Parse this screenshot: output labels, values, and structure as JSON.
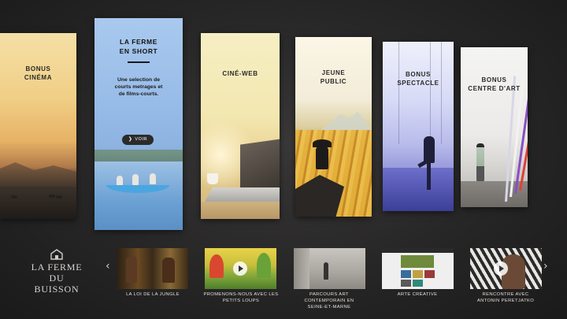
{
  "cards": [
    {
      "title": "BONUS\nCINÉMA"
    },
    {
      "title": "LA FERME\nEN SHORT",
      "description": "Une selection de\ncourts metrages et\nde films-courts.",
      "button_label": "VOIR"
    },
    {
      "title": "CINÉ-WEB"
    },
    {
      "title": "JEUNE\nPUBLIC"
    },
    {
      "title": "BONUS\nSPECTACLE"
    },
    {
      "title": "BONUS\nCENTRE D'ART"
    }
  ],
  "logo": {
    "line1": "LA FERME",
    "line2": "DU BUISSON"
  },
  "carousel": {
    "prev_arrow": "‹",
    "next_arrow": "›",
    "items": [
      {
        "caption": "LA LOI DE LA JUNGLE"
      },
      {
        "caption": "PROMENONS-NOUS AVEC LES\nPETITS LOUPS"
      },
      {
        "caption": "PARCOURS ART\nCONTEMPORAIN EN\nSEINE-ET-MARNE"
      },
      {
        "caption": "ARTE CRÉATIVE"
      },
      {
        "caption": "RENCONTRE AVEC\nANTONIN PERETJATKO"
      }
    ]
  },
  "icons": {
    "house": "house-icon",
    "play": "play-icon",
    "chevron": "chevron-icon"
  },
  "colors": {
    "background": "#272626",
    "featured_card": "#98bce8",
    "button": "#2b2b2b"
  }
}
